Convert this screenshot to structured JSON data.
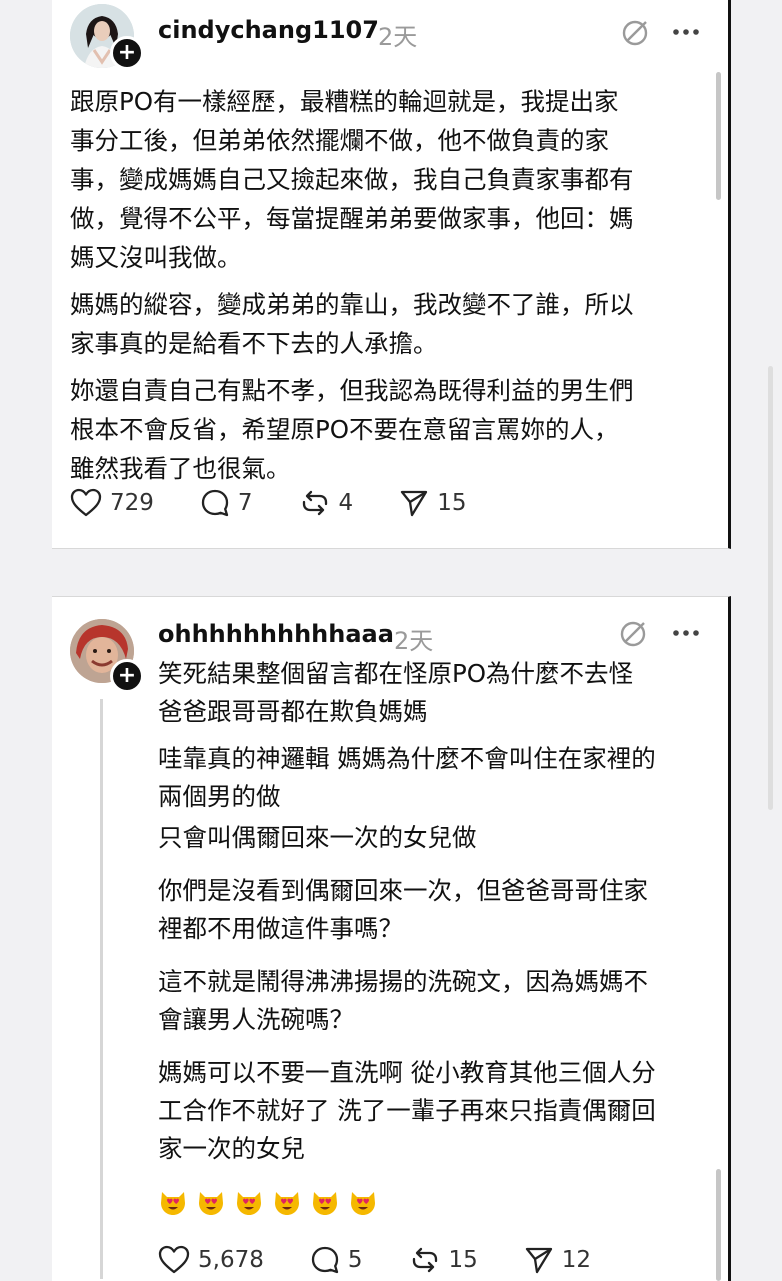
{
  "posts": [
    {
      "username": "cindychang1107",
      "time": "2天",
      "paragraphs": [
        [
          "跟原PO有一樣經歷，最糟糕的輪迴就是，我提出家",
          "事分工後，但弟弟依然擺爛不做，他不做負責的家",
          "事，變成媽媽自己又撿起來做，我自己負責家事都有",
          "做，覺得不公平，每當提醒弟弟要做家事，他回：媽",
          "媽又沒叫我做。"
        ],
        [
          "媽媽的縱容，變成弟弟的靠山，我改變不了誰，所以",
          "家事真的是給看不下去的人承擔。"
        ],
        [
          "妳還自責自己有點不孝，但我認為既得利益的男生們",
          "根本不會反省，希望原PO不要在意留言罵妳的人，",
          "雖然我看了也很氣。"
        ]
      ],
      "stats": {
        "likes": "729",
        "comments": "7",
        "reposts": "4",
        "shares": "15"
      }
    },
    {
      "username": "ohhhhhhhhhhaaa",
      "time": "2天",
      "paragraphs": [
        [
          "笑死結果整個留言都在怪原PO為什麼不去怪",
          "爸爸跟哥哥都在欺負媽媽"
        ],
        [
          "哇靠真的神邏輯 媽媽為什麼不會叫住在家裡的",
          "兩個男的做"
        ],
        [
          "只會叫偶爾回來一次的女兒做"
        ],
        [
          "你們是沒看到偶爾回來一次，但爸爸哥哥住家",
          "裡都不用做這件事嗎？"
        ],
        [
          "這不就是鬧得沸沸揚揚的洗碗文，因為媽媽不",
          "會讓男人洗碗嗎？"
        ],
        [
          "媽媽可以不要一直洗啊 從小教育其他三個人分",
          "工合作不就好了 洗了一輩子再來只指責偶爾回",
          "家一次的女兒"
        ]
      ],
      "emojis": [
        "heart-eyes-cat",
        "heart-eyes-cat",
        "heart-eyes-cat",
        "heart-eyes-cat",
        "heart-eyes-cat",
        "heart-eyes-cat"
      ],
      "stats": {
        "likes": "5,678",
        "comments": "5",
        "reposts": "15",
        "shares": "12"
      }
    }
  ],
  "icons": {
    "like": "heart-icon",
    "comment": "comment-icon",
    "repost": "repost-icon",
    "share": "share-icon",
    "edit": "slashed-circle-icon",
    "more": "more-icon"
  },
  "colors": {
    "text": "#111111",
    "secondary": "#9a9a9a",
    "divider": "#d8d8d8",
    "emoji": "#f5b800"
  }
}
